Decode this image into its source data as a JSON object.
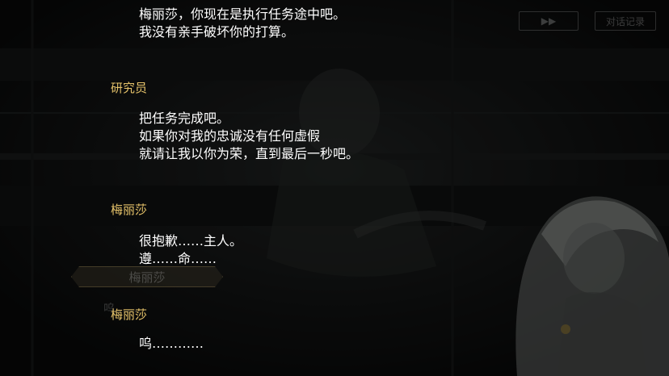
{
  "hud": {
    "auto_label": "▶▶",
    "log_label": "对话记录"
  },
  "background": {
    "nameplate": "梅丽莎",
    "text": "呜……"
  },
  "log": [
    {
      "speaker": "",
      "lines": [
        "梅丽莎，你现在是执行任务途中吧。",
        "我没有亲手破坏你的打算。"
      ]
    },
    {
      "speaker": "研究员",
      "lines": [
        "把任务完成吧。",
        "如果你对我的忠诚没有任何虚假",
        "就请让我以你为荣，直到最后一秒吧。"
      ]
    },
    {
      "speaker": "梅丽莎",
      "lines": [
        "很抱歉……主人。",
        "遵……命……"
      ]
    },
    {
      "speaker": "梅丽莎",
      "lines": [
        "呜…………"
      ]
    }
  ]
}
